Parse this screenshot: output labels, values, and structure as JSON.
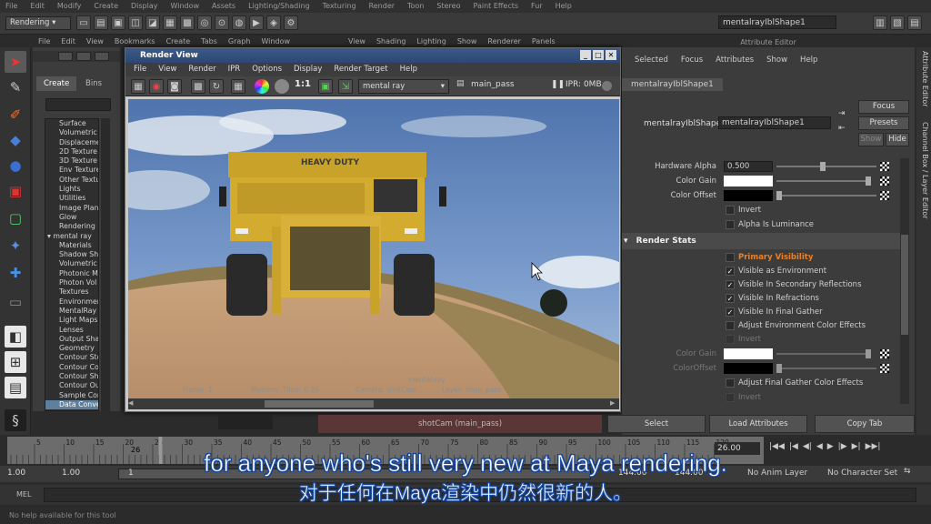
{
  "main_menu": [
    "File",
    "Edit",
    "Modify",
    "Create",
    "Display",
    "Window",
    "Assets",
    "Lighting/Shading",
    "Texturing",
    "Render",
    "Toon",
    "Stereo",
    "Paint Effects",
    "Fur",
    "Help"
  ],
  "mode_dropdown": "Rendering",
  "node_field": "mentalrayIblShape1",
  "hypershade_menu": [
    "File",
    "Edit",
    "View",
    "Bookmarks",
    "Create",
    "Tabs",
    "Graph",
    "Window"
  ],
  "hypershade_menu2": [
    "View",
    "Shading",
    "Lighting",
    "Show",
    "Renderer",
    "Panels"
  ],
  "outliner": {
    "tabs": [
      "Create",
      "Bins"
    ],
    "items": [
      "Surface",
      "Volumetric",
      "Displaceme",
      "2D Texture",
      "3D Texture",
      "Env Texture",
      "Other Textu",
      "Lights",
      "Utilities",
      "Image Plan",
      "Glow",
      "Rendering",
      "mental ray",
      "Materials",
      "Shadow Sh",
      "Volumetric",
      "Photonic M",
      "Photon Vol",
      "Textures",
      "Environmer",
      "MentalRay",
      "Light Maps",
      "Lenses",
      "Output Sha",
      "Geometry",
      "Contour Sto",
      "Contour Co",
      "Contour Sh",
      "Contour Ou",
      "Sample Cor",
      "Data Conve"
    ],
    "selected_index": 30
  },
  "render_view": {
    "title": "Render View",
    "menu": [
      "File",
      "View",
      "Render",
      "IPR",
      "Options",
      "Display",
      "Render Target",
      "Help"
    ],
    "ratio": "1:1",
    "renderer": "mental ray",
    "pass": "main_pass",
    "ipr": "IPR: 0MB",
    "truck_text": "HEAVY DUTY",
    "overlay_line1": "mental ray",
    "overlay_line2_a": "Frame: 1",
    "overlay_line2_b": "Memory: Time: 0:26",
    "overlay_line2_c": "Camera: shotCam",
    "overlay_line2_d": "Layer: main_pass"
  },
  "attribute_editor": {
    "title": "Attribute Editor",
    "menu": [
      "Selected",
      "Focus",
      "Attributes",
      "Show",
      "Help"
    ],
    "tab": "mentalrayIblShape1",
    "node_label": "mentalrayIblShape:",
    "node_value": "mentalrayIblShape1",
    "buttons": {
      "focus": "Focus",
      "presets": "Presets",
      "show": "Show",
      "hide": "Hide"
    },
    "hardware_alpha_label": "Hardware Alpha",
    "hardware_alpha_value": "0.500",
    "color_gain_label": "Color Gain",
    "color_offset_label": "Color Offset",
    "invert_label": "Invert",
    "alpha_lum_label": "Alpha Is Luminance",
    "section": "Render Stats",
    "primary_visibility": "Primary Visibility",
    "checks": [
      {
        "label": "Visible as Environment",
        "on": true
      },
      {
        "label": "Visible In Secondary Reflections",
        "on": true
      },
      {
        "label": "Visible In Refractions",
        "on": true
      },
      {
        "label": "Visible In Final Gather",
        "on": true
      },
      {
        "label": "Adjust Environment Color Effects",
        "on": false
      }
    ],
    "invert2": "Invert",
    "color_gain2": "Color Gain",
    "color_offset2": "ColorOffset",
    "adjust_fg": "Adjust Final Gather Color Effects",
    "invert3": "Invert",
    "bottom_buttons": [
      "Select",
      "Load Attributes",
      "Copy Tab"
    ]
  },
  "side_tabs": [
    "Attribute Editor",
    "Channel Box / Layer Editor"
  ],
  "status_camera": "shotCam (main_pass)",
  "timeline": {
    "ticks": [
      "5",
      "10",
      "15",
      "20",
      "25",
      "30",
      "35",
      "40",
      "45",
      "50",
      "55",
      "60",
      "65",
      "70",
      "75",
      "80",
      "85",
      "90",
      "95",
      "100",
      "105",
      "110",
      "115",
      "120"
    ],
    "current_frame": "26",
    "end_field": "26.00",
    "range_start": "1.00",
    "range_start2": "1.00",
    "range_mark": "1",
    "range_end": "144.00",
    "range_end2": "144.00",
    "anim_layer": "No Anim Layer",
    "character_set": "No Character Set"
  },
  "mel_label": "MEL",
  "help_line": "No help available for this tool",
  "subtitle_en": "for anyone who's still very new at Maya rendering.",
  "subtitle_zh": "对于任何在Maya渲染中仍然很新的人。"
}
